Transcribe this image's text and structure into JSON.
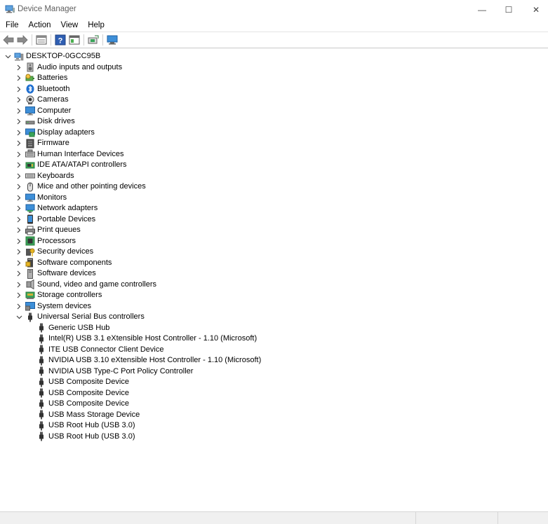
{
  "window": {
    "title": "Device Manager",
    "minimize_glyph": "—",
    "maximize_glyph": "☐",
    "close_glyph": "✕"
  },
  "menu": [
    "File",
    "Action",
    "View",
    "Help"
  ],
  "toolbar": {
    "buttons": [
      "back-icon",
      "forward-icon",
      "properties-icon",
      "help-icon",
      "action-pane-icon",
      "update-driver-icon",
      "scan-hardware-icon"
    ]
  },
  "tree": {
    "root": "DESKTOP-0GCC95B",
    "categories": [
      {
        "label": "Audio inputs and outputs",
        "icon": "speaker-icon"
      },
      {
        "label": "Batteries",
        "icon": "battery-icon"
      },
      {
        "label": "Bluetooth",
        "icon": "bluetooth-icon"
      },
      {
        "label": "Cameras",
        "icon": "camera-icon"
      },
      {
        "label": "Computer",
        "icon": "computer-icon"
      },
      {
        "label": "Disk drives",
        "icon": "disk-drive-icon"
      },
      {
        "label": "Display adapters",
        "icon": "display-adapter-icon"
      },
      {
        "label": "Firmware",
        "icon": "firmware-icon"
      },
      {
        "label": "Human Interface Devices",
        "icon": "hid-icon"
      },
      {
        "label": "IDE ATA/ATAPI controllers",
        "icon": "ide-controller-icon"
      },
      {
        "label": "Keyboards",
        "icon": "keyboard-icon"
      },
      {
        "label": "Mice and other pointing devices",
        "icon": "mouse-icon"
      },
      {
        "label": "Monitors",
        "icon": "monitor-icon"
      },
      {
        "label": "Network adapters",
        "icon": "network-adapter-icon"
      },
      {
        "label": "Portable Devices",
        "icon": "portable-device-icon"
      },
      {
        "label": "Print queues",
        "icon": "printer-icon"
      },
      {
        "label": "Processors",
        "icon": "processor-icon"
      },
      {
        "label": "Security devices",
        "icon": "security-device-icon"
      },
      {
        "label": "Software components",
        "icon": "software-component-icon"
      },
      {
        "label": "Software devices",
        "icon": "software-device-icon"
      },
      {
        "label": "Sound, video and game controllers",
        "icon": "sound-controller-icon"
      },
      {
        "label": "Storage controllers",
        "icon": "storage-controller-icon"
      },
      {
        "label": "System devices",
        "icon": "system-device-icon"
      },
      {
        "label": "Universal Serial Bus controllers",
        "icon": "usb-icon",
        "expanded": true
      }
    ],
    "usb_children": [
      "Generic USB Hub",
      "Intel(R) USB 3.1 eXtensible Host Controller - 1.10 (Microsoft)",
      "ITE USB Connector Client Device",
      "NVIDIA USB 3.10 eXtensible Host Controller - 1.10 (Microsoft)",
      "NVIDIA USB Type-C Port Policy Controller",
      "USB Composite Device",
      "USB Composite Device",
      "USB Composite Device",
      "USB Mass Storage Device",
      "USB Root Hub (USB 3.0)",
      "USB Root Hub (USB 3.0)"
    ]
  },
  "colors": {
    "accent_blue": "#1e73c8",
    "icon_gray": "#555555",
    "chevron": "#444444"
  }
}
